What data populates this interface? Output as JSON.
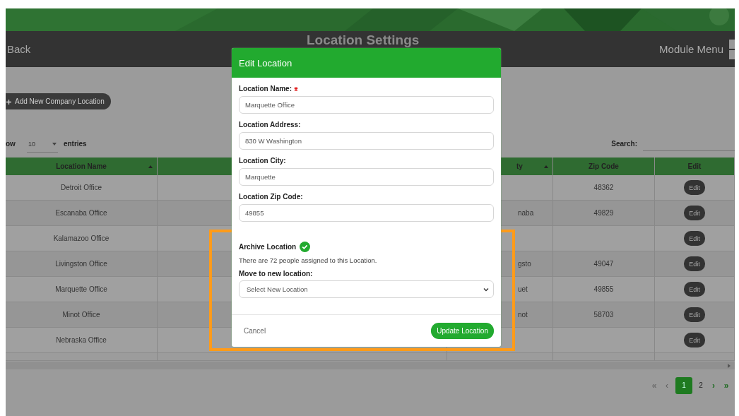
{
  "header": {
    "back": "Back",
    "title": "Location Settings",
    "menu": "Module Menu"
  },
  "toolbar": {
    "add_button": "Add New Company Location",
    "show_label": "ow",
    "page_size": "10",
    "entries_label": "entries",
    "search_label": "Search:"
  },
  "table": {
    "columns": [
      {
        "label": "Location Name",
        "sort_arrow": true
      },
      {
        "label": "ty",
        "sort_arrow": true
      },
      {
        "label": "Zip Code",
        "sort_arrow": false
      },
      {
        "label": "Edit",
        "sort_arrow": false
      }
    ],
    "rows": [
      {
        "name": "Detroit Office",
        "zip": "48362",
        "edit": "Edit"
      },
      {
        "name": "Escanaba Office",
        "city": "naba",
        "zip": "49829",
        "edit": "Edit"
      },
      {
        "name": "Kalamazoo Office",
        "edit": "Edit"
      },
      {
        "name": "Livingston Office",
        "city": "gsto",
        "zip": "49047",
        "edit": "Edit"
      },
      {
        "name": "Marquette Office",
        "city": "uet",
        "zip": "49855",
        "edit": "Edit"
      },
      {
        "name": "Minot Office",
        "city": "not",
        "zip": "58703",
        "edit": "Edit"
      },
      {
        "name": "Nebraska Office",
        "edit": "Edit"
      }
    ]
  },
  "pagination": [
    {
      "kind": "nav",
      "label": "«",
      "disabled": true
    },
    {
      "kind": "nav",
      "label": "‹",
      "disabled": true
    },
    {
      "kind": "page",
      "label": "1",
      "selected": true
    },
    {
      "kind": "page",
      "label": "2",
      "selected": false
    },
    {
      "kind": "nav",
      "label": "›",
      "disabled": false
    },
    {
      "kind": "nav",
      "label": "»",
      "disabled": false
    }
  ],
  "modal": {
    "title": "Edit Location",
    "fields": [
      {
        "label": "Location Name:",
        "required": true,
        "value": "Marquette Office"
      },
      {
        "label": "Location Address:",
        "required": false,
        "value": "830 W Washington"
      },
      {
        "label": "Location City:",
        "required": false,
        "value": "Marquette"
      },
      {
        "label": "Location Zip Code:",
        "required": false,
        "value": "49855"
      }
    ],
    "archive": {
      "label": "Archive Location",
      "checked": true,
      "note": "There are 72 people assigned to this Location.",
      "move_label": "Move to new location:",
      "select_placeholder": "Select New Location"
    },
    "cancel": "Cancel",
    "submit": "Update Location"
  }
}
